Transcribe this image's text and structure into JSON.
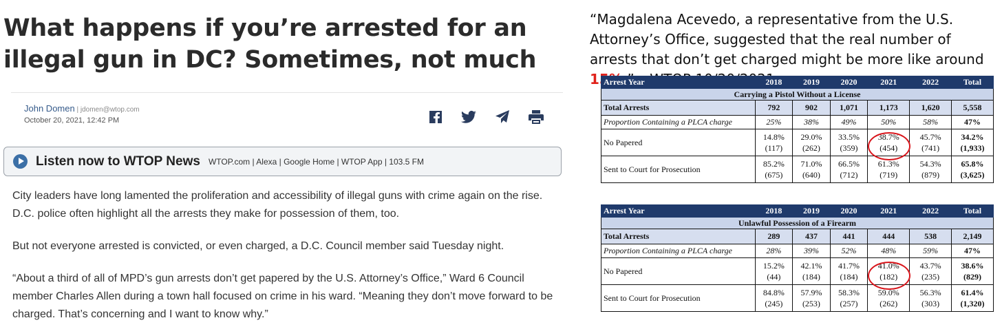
{
  "article": {
    "headline": "What happens if you’re arrested for an illegal gun in DC? Sometimes, not much",
    "author": "John Domen",
    "separator": " | ",
    "email": "jdomen@wtop.com",
    "date": "October 20, 2021, 12:42 PM",
    "share_icons": [
      "facebook-icon",
      "twitter-icon",
      "send-icon",
      "print-icon"
    ],
    "listen": {
      "title": "Listen now to WTOP News",
      "platforms": "WTOP.com | Alexa | Google Home | WTOP App | 103.5 FM"
    },
    "paragraphs": [
      "City leaders have long lamented the proliferation and accessibility of illegal guns with crime again on the rise. D.C. police often highlight all the arrests they make for possession of them, too.",
      "But not everyone arrested is convicted, or even charged, a D.C. Council member said Tuesday night.",
      "“About a third of all of MPD’s gun arrests don’t get papered by the U.S. Attorney’s Office,” Ward 6 Council member Charles Allen during a town hall focused on crime in his ward. “Meaning they don’t move forward to be charged. That’s concerning and I want to know why.”"
    ]
  },
  "quote": {
    "before": "“Magdalena Acevedo, a representative from the U.S. Attorney’s Office, suggested that the real number of arrests that don’t get charged might be more like around ",
    "highlight": "15%",
    "after": ".” – WTOP 10/20/2021"
  },
  "tables": [
    {
      "columns": [
        "Arrest Year",
        "2018",
        "2019",
        "2020",
        "2021",
        "2022",
        "Total"
      ],
      "subtitle": "Carrying a Pistol Without a License",
      "total_label": "Total Arrests",
      "totals": [
        "792",
        "902",
        "1,071",
        "1,173",
        "1,620",
        "5,558"
      ],
      "prop_label": "Proportion Containing a PLCA charge",
      "prop": [
        "25%",
        "38%",
        "49%",
        "50%",
        "58%",
        "47%"
      ],
      "rows": [
        {
          "label": "No Papered",
          "pct": [
            "14.8%",
            "29.0%",
            "33.5%",
            "38.7%",
            "45.7%",
            "34.2%"
          ],
          "n": [
            "(117)",
            "(262)",
            "(359)",
            "(454)",
            "(741)",
            "(1,933)"
          ]
        },
        {
          "label": "Sent to Court for Prosecution",
          "pct": [
            "85.2%",
            "71.0%",
            "66.5%",
            "61.3%",
            "54.3%",
            "65.8%"
          ],
          "n": [
            "(675)",
            "(640)",
            "(712)",
            "(719)",
            "(879)",
            "(3,625)"
          ]
        }
      ]
    },
    {
      "columns": [
        "Arrest Year",
        "2018",
        "2019",
        "2020",
        "2021",
        "2022",
        "Total"
      ],
      "subtitle": "Unlawful Possession of a Firearm",
      "total_label": "Total Arrests",
      "totals": [
        "289",
        "437",
        "441",
        "444",
        "538",
        "2,149"
      ],
      "prop_label": "Proportion Containing a PLCA charge",
      "prop": [
        "28%",
        "39%",
        "52%",
        "48%",
        "59%",
        "47%"
      ],
      "rows": [
        {
          "label": "No Papered",
          "pct": [
            "15.2%",
            "42.1%",
            "41.7%",
            "41.0%",
            "43.7%",
            "38.6%"
          ],
          "n": [
            "(44)",
            "(184)",
            "(184)",
            "(182)",
            "(235)",
            "(829)"
          ]
        },
        {
          "label": "Sent to Court for Prosecution",
          "pct": [
            "84.8%",
            "57.9%",
            "58.3%",
            "59.0%",
            "56.3%",
            "61.4%"
          ],
          "n": [
            "(245)",
            "(253)",
            "(257)",
            "(262)",
            "(303)",
            "(1,320)"
          ]
        }
      ]
    }
  ],
  "accent": "#e0221b"
}
